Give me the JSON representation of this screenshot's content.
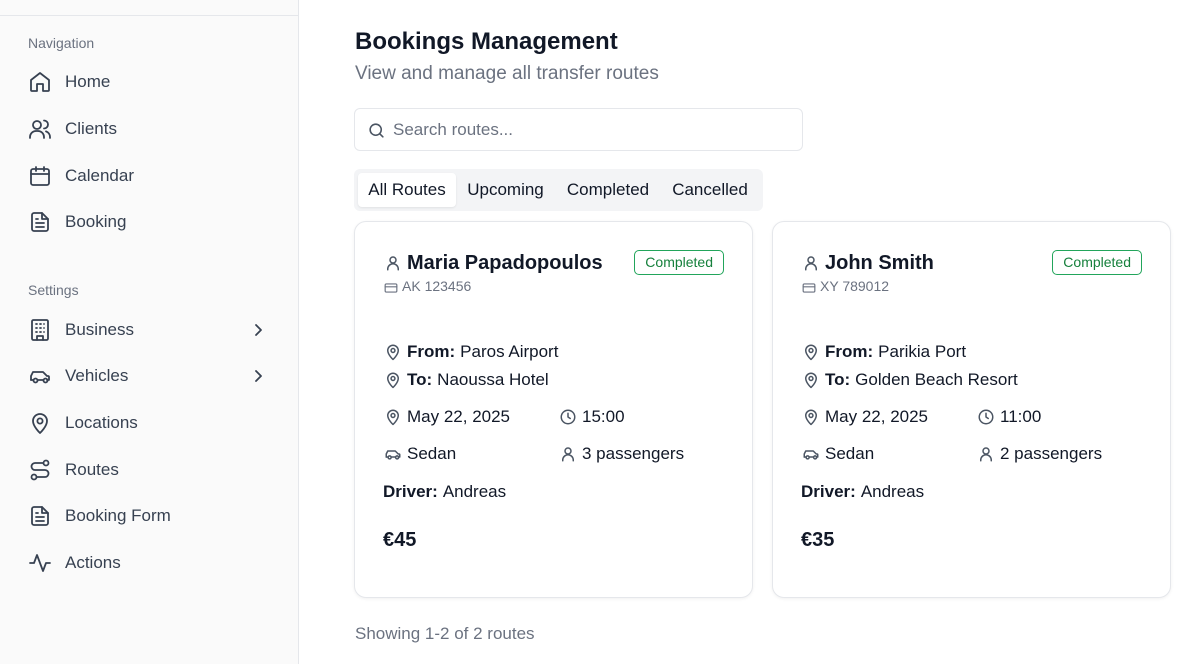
{
  "sidebar": {
    "sections": [
      {
        "label": "Navigation",
        "items": [
          {
            "label": "Home",
            "icon": "home-icon"
          },
          {
            "label": "Clients",
            "icon": "users-icon"
          },
          {
            "label": "Calendar",
            "icon": "calendar-icon"
          },
          {
            "label": "Booking",
            "icon": "file-text-icon"
          }
        ]
      },
      {
        "label": "Settings",
        "items": [
          {
            "label": "Business",
            "icon": "building-icon",
            "has_children": true
          },
          {
            "label": "Vehicles",
            "icon": "car-icon",
            "has_children": true
          },
          {
            "label": "Locations",
            "icon": "map-pin-icon"
          },
          {
            "label": "Routes",
            "icon": "route-icon"
          },
          {
            "label": "Booking Form",
            "icon": "file-text-icon"
          },
          {
            "label": "Actions",
            "icon": "activity-icon"
          }
        ]
      }
    ]
  },
  "main": {
    "title": "Bookings Management",
    "subtitle": "View and manage all transfer routes",
    "search": {
      "placeholder": "Search routes...",
      "value": ""
    },
    "tabs": [
      {
        "label": "All Routes",
        "active": true
      },
      {
        "label": "Upcoming",
        "active": false
      },
      {
        "label": "Completed",
        "active": false
      },
      {
        "label": "Cancelled",
        "active": false
      }
    ],
    "bookings": [
      {
        "client": "Maria Papadopoulos",
        "client_id": "AK 123456",
        "status": "Completed",
        "from_label": "From:",
        "from": "Paros Airport",
        "to_label": "To:",
        "to": "Naoussa Hotel",
        "date": "May 22, 2025",
        "time": "15:00",
        "vehicle": "Sedan",
        "passengers": "3 passengers",
        "driver_label": "Driver:",
        "driver": "Andreas",
        "price": "€45"
      },
      {
        "client": "John Smith",
        "client_id": "XY 789012",
        "status": "Completed",
        "from_label": "From:",
        "from": "Parikia Port",
        "to_label": "To:",
        "to": "Golden Beach Resort",
        "date": "May 22, 2025",
        "time": "11:00",
        "vehicle": "Sedan",
        "passengers": "2 passengers",
        "driver_label": "Driver:",
        "driver": "Andreas",
        "price": "€35"
      }
    ],
    "footer": "Showing 1-2 of 2 routes"
  },
  "colors": {
    "status_completed": "#16803c",
    "text_primary": "#111827",
    "text_muted": "#6b7280",
    "sidebar_bg": "#fafafa"
  }
}
